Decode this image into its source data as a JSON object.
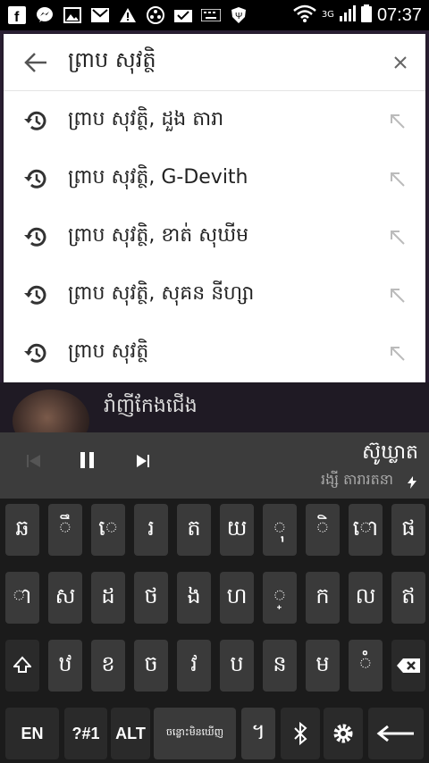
{
  "status": {
    "time": "07:37",
    "network": "3G"
  },
  "search": {
    "query": "ព្រាប សុវត្ថិ"
  },
  "suggestions": [
    {
      "text": "ព្រាប សុវត្ថិ, ដួង តារា"
    },
    {
      "text": "ព្រាប សុវត្ថិ, G-Devith"
    },
    {
      "text": "ព្រាប សុវត្ថិ, ខាត់ សុឃីម"
    },
    {
      "text": "ព្រាប សុវត្ថិ, សុគន នីហ្សា"
    },
    {
      "text": "ព្រាប សុវត្ថិ"
    }
  ],
  "now_playing": {
    "title": "រាំញីកែងជើង"
  },
  "media": {
    "song": "ស៊ូឃ្លាត",
    "artist": "រង្សី តារារតនា"
  },
  "keyboard": {
    "row1": [
      "ឆ",
      "ឹ",
      "េ",
      "រ",
      "ត",
      "យ",
      "ុ",
      "ិ",
      "ោ",
      "ផ"
    ],
    "row2": [
      "ា",
      "ស",
      "ដ",
      "ថ",
      "ង",
      "ហ",
      "្",
      "ក",
      "ល",
      "ឥ"
    ],
    "row3": [
      "ឋ",
      "ខ",
      "ច",
      "វ",
      "ប",
      "ន",
      "ម",
      "ំ"
    ],
    "row4": {
      "lang": "EN",
      "sym": "?#1",
      "alt": "ALT",
      "space": "ចន្លោះមិនឃើញ",
      "punct": "។"
    }
  }
}
